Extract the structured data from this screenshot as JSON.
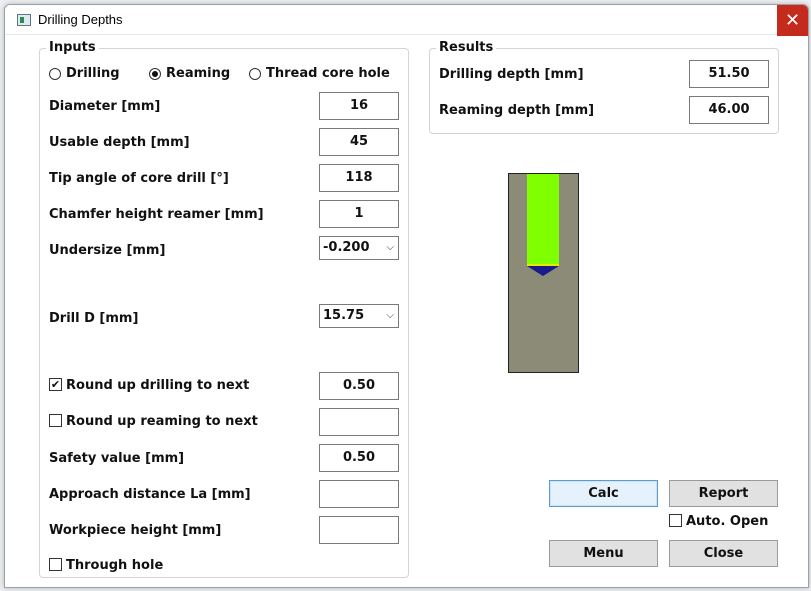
{
  "window": {
    "title": "Drilling Depths",
    "close_glyph": "✕"
  },
  "inputs": {
    "legend": "Inputs",
    "modes": [
      {
        "label": "Drilling",
        "selected": false
      },
      {
        "label": "Reaming",
        "selected": true
      },
      {
        "label": "Thread core hole",
        "selected": false
      }
    ],
    "diameter": {
      "label": "Diameter [mm]",
      "value": "16"
    },
    "usable_depth": {
      "label": "Usable depth [mm]",
      "value": "45"
    },
    "tip_angle": {
      "label": "Tip angle of core drill [°]",
      "value": "118"
    },
    "chamfer_height": {
      "label": "Chamfer height reamer [mm]",
      "value": "1"
    },
    "undersize": {
      "label": "Undersize [mm]",
      "value": "-0.200"
    },
    "drill_d": {
      "label": "Drill D [mm]",
      "value": "15.75"
    },
    "round_up_drilling": {
      "label": "Round up drilling to next",
      "checked": true,
      "value": "0.50"
    },
    "round_up_reaming": {
      "label": "Round up reaming to next",
      "checked": false,
      "value": ""
    },
    "safety_value": {
      "label": "Safety value [mm]",
      "value": "0.50"
    },
    "approach_distance": {
      "label": "Approach distance La [mm]",
      "value": ""
    },
    "workpiece_height": {
      "label": "Workpiece height [mm]",
      "value": ""
    },
    "through_hole": {
      "label": "Through hole",
      "checked": false
    }
  },
  "results": {
    "legend": "Results",
    "drilling_depth": {
      "label": "Drilling depth [mm]",
      "value": "51.50"
    },
    "reaming_depth": {
      "label": "Reaming depth [mm]",
      "value": "46.00"
    }
  },
  "buttons": {
    "calc": "Calc",
    "report": "Report",
    "auto_open": {
      "label": "Auto. Open",
      "checked": false
    },
    "menu": "Menu",
    "close": "Close"
  },
  "drawing": {
    "workpiece_color": "#8b8b78",
    "tool_color": "#80ff00",
    "tip_color": "#1a1a8c",
    "tip_edge_color": "#e8e800",
    "check_glyph": "✔",
    "chevron_glyph": "⌵"
  }
}
